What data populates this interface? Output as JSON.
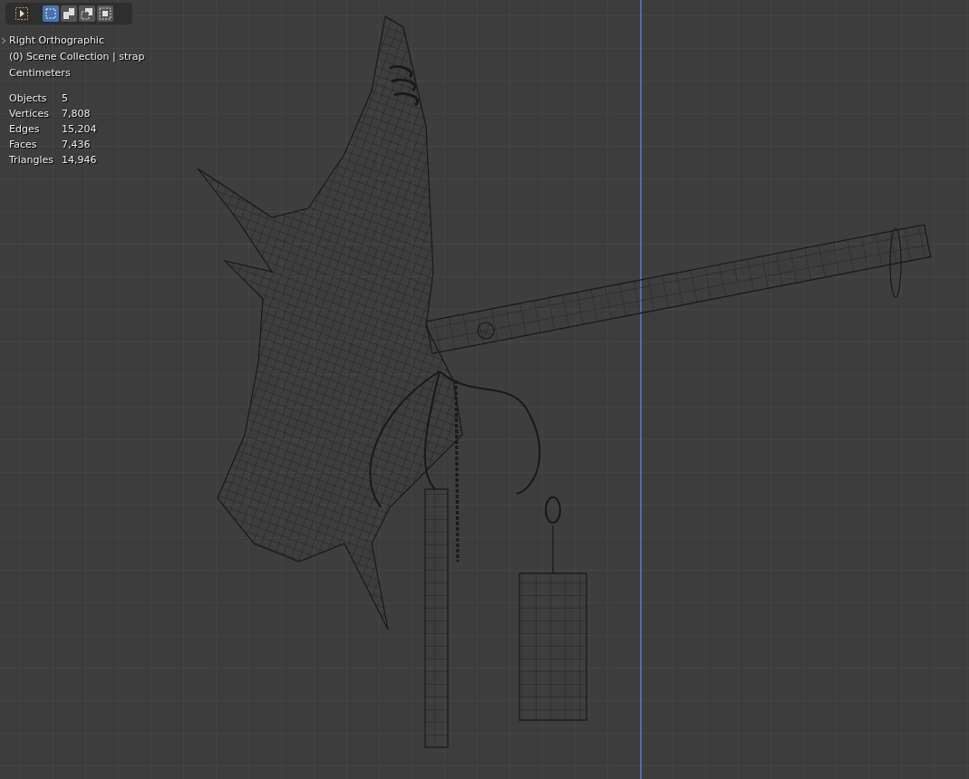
{
  "toolbar": {
    "tools": [
      {
        "kind": "tweak",
        "selected": false
      },
      {
        "kind": "new",
        "selected": true
      },
      {
        "kind": "extend",
        "selected": false
      },
      {
        "kind": "subtract",
        "selected": false
      },
      {
        "kind": "intersect",
        "selected": false
      }
    ]
  },
  "overlay": {
    "view": "Right Orthographic",
    "collection": "(0) Scene Collection | strap",
    "units": "Centimeters",
    "stats": [
      {
        "label": "Objects",
        "value": "5"
      },
      {
        "label": "Vertices",
        "value": "7,808"
      },
      {
        "label": "Edges",
        "value": "15,204"
      },
      {
        "label": "Faces",
        "value": "7,436"
      },
      {
        "label": "Triangles",
        "value": "14,946"
      }
    ]
  }
}
